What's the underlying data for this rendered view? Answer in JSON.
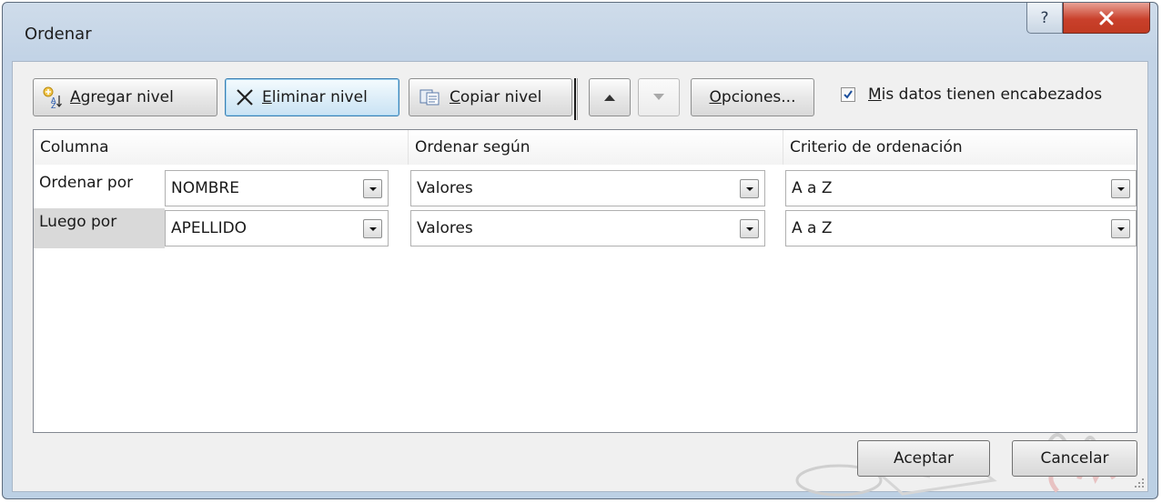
{
  "window": {
    "title": "Ordenar",
    "help_icon": "question-icon",
    "close_icon": "close-icon"
  },
  "toolbar": {
    "add_level": {
      "prefix": "",
      "mnemonic": "A",
      "rest": "gregar nivel",
      "icon": "add-level-sort-icon"
    },
    "delete_level": {
      "mnemonic": "E",
      "rest": "liminar nivel",
      "icon": "x-delete-icon"
    },
    "copy_level": {
      "mnemonic": "C",
      "rest": "opiar nivel",
      "icon": "copy-icon"
    },
    "move_up": {
      "icon": "arrow-up-icon",
      "enabled": true
    },
    "move_down": {
      "icon": "arrow-down-icon",
      "enabled": false
    },
    "options": {
      "mnemonic": "O",
      "rest": "pciones..."
    },
    "headers_checkbox": {
      "checked": true,
      "mnemonic": "M",
      "rest": "is datos tienen encabezados"
    }
  },
  "grid": {
    "headers": [
      "Columna",
      "Ordenar según",
      "Criterio de ordenación"
    ],
    "rows": [
      {
        "label": "Ordenar por",
        "column": "NOMBRE",
        "sort_on": "Valores",
        "order": "A a Z",
        "selected": false
      },
      {
        "label": "Luego por",
        "column": "APELLIDO",
        "sort_on": "Valores",
        "order": "A a Z",
        "selected": true
      }
    ]
  },
  "buttons": {
    "ok": "Aceptar",
    "cancel": "Cancelar"
  },
  "colors": {
    "focus_border": "#3c7fb1",
    "selected_row": "#d9d9d9",
    "close_red": "#c9402b"
  }
}
